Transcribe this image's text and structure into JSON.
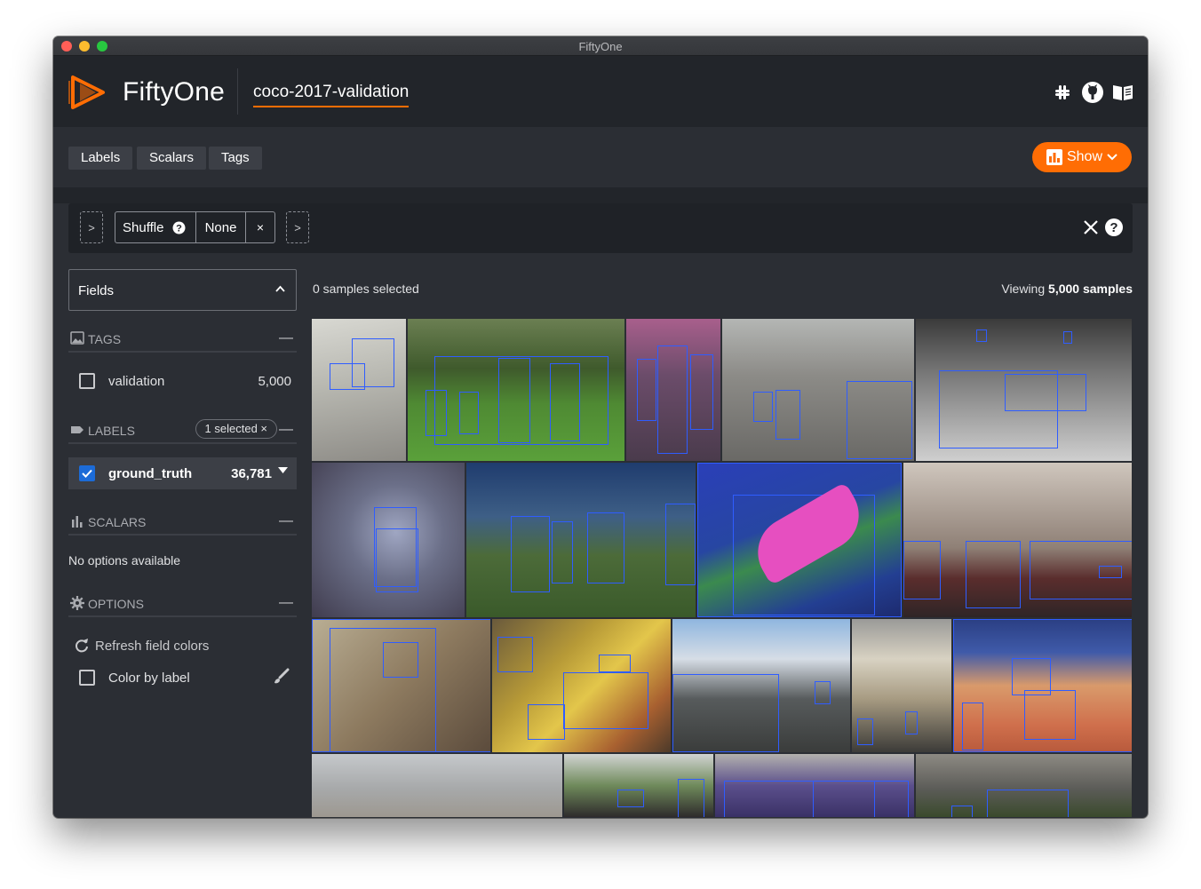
{
  "window": {
    "title": "FiftyOne"
  },
  "header": {
    "app_name": "FiftyOne",
    "dataset_name": "coco-2017-validation",
    "icons": [
      "slack-icon",
      "github-icon",
      "docs-book-icon"
    ]
  },
  "tabs": {
    "labels": "Labels",
    "scalars": "Scalars",
    "tags": "Tags",
    "show": "Show"
  },
  "view_bar": {
    "stage_name": "Shuffle",
    "stage_param": "None",
    "add_stage_symbol": ">",
    "remove_symbol": "×"
  },
  "sidebar": {
    "fields_label": "Fields",
    "tags_header": "TAGS",
    "tags": [
      {
        "name": "validation",
        "count": "5,000",
        "checked": false
      }
    ],
    "labels_header": "LABELS",
    "labels_chip": "1 selected ×",
    "labels": [
      {
        "name": "ground_truth",
        "count": "36,781",
        "checked": true
      }
    ],
    "scalars_header": "SCALARS",
    "scalars_empty": "No options available",
    "options_header": "OPTIONS",
    "refresh_colors": "Refresh field colors",
    "color_by_label": "Color by label",
    "collapse_symbol": "—"
  },
  "main": {
    "samples_selected": "0 samples selected",
    "viewing_prefix": "Viewing",
    "viewing_count": "5,000 samples"
  },
  "colors": {
    "accent": "#ff6d04",
    "box": "#2f5dff",
    "checkbox": "#1c6bd7",
    "bg": "#2b2e34",
    "header_bg": "#22252a"
  }
}
